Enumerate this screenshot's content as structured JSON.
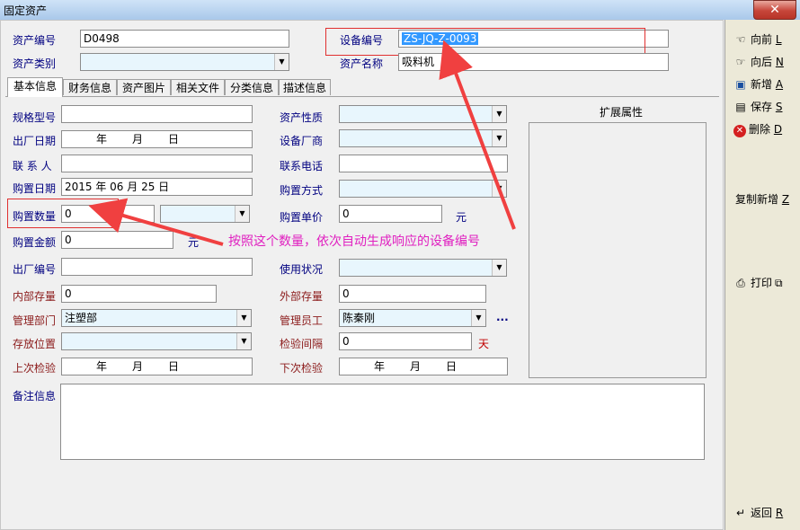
{
  "window": {
    "title": "固定资产",
    "close": "✕"
  },
  "top_fields": {
    "asset_no_label": "资产编号",
    "asset_no_value": "D0498",
    "device_no_label": "设备编号",
    "device_no_value": "ZS-JQ-Z-0093",
    "asset_type_label": "资产类别",
    "asset_type_value": "",
    "asset_name_label": "资产名称",
    "asset_name_value": "吸料机"
  },
  "tabs": [
    "基本信息",
    "财务信息",
    "资产图片",
    "相关文件",
    "分类信息",
    "描述信息"
  ],
  "left_fields": {
    "spec_label": "规格型号",
    "factory_date_label": "出厂日期",
    "contact_label": "联 系 人",
    "purchase_date_label": "购置日期",
    "purchase_date_value": "2015 年 06 月 25 日",
    "purchase_qty_label": "购置数量",
    "purchase_qty_value": "0",
    "purchase_amount_label": "购置金额",
    "purchase_amount_value": "0",
    "serial_label": "出厂编号",
    "internal_stock_label": "内部存量",
    "internal_stock_value": "0",
    "dept_label": "管理部门",
    "dept_value": "注塑部",
    "location_label": "存放位置",
    "last_check_label": "上次检验",
    "yuan": "元",
    "date_year": "年",
    "date_month": "月",
    "date_day": "日"
  },
  "right_fields": {
    "nature_label": "资产性质",
    "maker_label": "设备厂商",
    "phone_label": "联系电话",
    "method_label": "购置方式",
    "unit_price_label": "购置单价",
    "unit_price_value": "0",
    "usage_label": "使用状况",
    "external_stock_label": "外部存量",
    "external_stock_value": "0",
    "manager_label": "管理员工",
    "manager_value": "陈秦刚",
    "more": "...",
    "interval_label": "检验间隔",
    "interval_value": "0",
    "day_unit": "天",
    "next_check_label": "下次检验"
  },
  "ext_title": "扩展属性",
  "notes_label": "备注信息",
  "annotation": "按照这个数量，依次自动生成响应的设备编号",
  "side_buttons": {
    "prev": {
      "label": "向前",
      "key": "L",
      "icon": "hand-left-icon"
    },
    "next": {
      "label": "向后",
      "key": "N",
      "icon": "hand-right-icon"
    },
    "add": {
      "label": "新增",
      "key": "A",
      "icon": "new-doc-icon"
    },
    "save": {
      "label": "保存",
      "key": "S",
      "icon": "floppy-icon"
    },
    "delete": {
      "label": "删除",
      "key": "D",
      "icon": "delete-icon"
    },
    "copy_add": {
      "label": "复制新增",
      "key": "Z"
    },
    "print": {
      "label": "打印",
      "icon": "printer-icon"
    },
    "back": {
      "label": "返回",
      "key": "R",
      "icon": "back-icon"
    }
  },
  "colors": {
    "annotation": "#e020c0",
    "highlight_box": "#e03030",
    "selection": "#3399ff"
  }
}
